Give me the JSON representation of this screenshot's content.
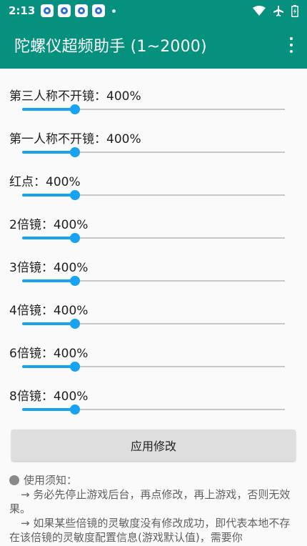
{
  "status_bar": {
    "time": "2:13"
  },
  "app_bar": {
    "title": "陀螺仪超频助手 (1~2000)"
  },
  "colors": {
    "primary": "#06917f",
    "accent": "#17a3f0",
    "button": "#dedede"
  },
  "settings": [
    {
      "label": "第三人称不开镜：400%",
      "value": 400,
      "max": 2000
    },
    {
      "label": "第一人称不开镜：400%",
      "value": 400,
      "max": 2000
    },
    {
      "label": "红点：400%",
      "value": 400,
      "max": 2000
    },
    {
      "label": "2倍镜：400%",
      "value": 400,
      "max": 2000
    },
    {
      "label": "3倍镜：400%",
      "value": 400,
      "max": 2000
    },
    {
      "label": "4倍镜：400%",
      "value": 400,
      "max": 2000
    },
    {
      "label": "6倍镜：400%",
      "value": 400,
      "max": 2000
    },
    {
      "label": "8倍镜：400%",
      "value": 400,
      "max": 2000
    }
  ],
  "apply_button": {
    "label": "应用修改"
  },
  "notes": {
    "title": "使用须知：",
    "items": [
      "→ 务必先停止游戏后台，再点修改，再上游戏，否则无效果。",
      "→ 如果某些倍镜的灵敏度没有修改成功，即代表本地不存在该倍镜的灵敏度配置信息(游戏默认值)，需要你"
    ]
  }
}
